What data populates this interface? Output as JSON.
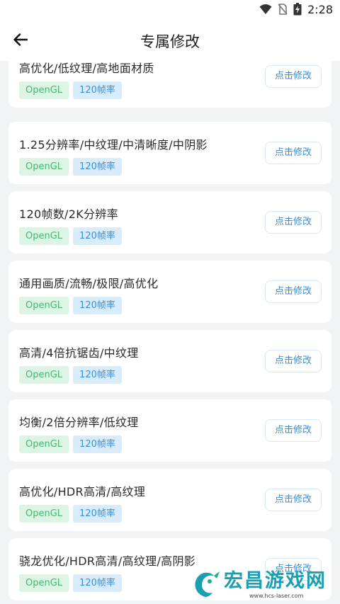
{
  "status_bar": {
    "time": "2:28"
  },
  "header": {
    "title": "专属修改"
  },
  "cards": [
    {
      "title": "高优化/低纹理/高地面材质",
      "tags": [
        "OpenGL",
        "120帧率"
      ],
      "button": "点击修改"
    },
    {
      "title": "1.25分辨率/中纹理/中清晰度/中阴影",
      "tags": [
        "OpenGL",
        "120帧率"
      ],
      "button": "点击修改"
    },
    {
      "title": "120帧数/2K分辨率",
      "tags": [
        "OpenGL",
        "120帧率"
      ],
      "button": "点击修改"
    },
    {
      "title": "通用画质/流畅/极限/高优化",
      "tags": [
        "OpenGL",
        "120帧率"
      ],
      "button": "点击修改"
    },
    {
      "title": "高清/4倍抗锯齿/中纹理",
      "tags": [
        "OpenGL",
        "120帧率"
      ],
      "button": "点击修改"
    },
    {
      "title": "均衡/2倍分辨率/低纹理",
      "tags": [
        "OpenGL",
        "120帧率"
      ],
      "button": "点击修改"
    },
    {
      "title": "高优化/HDR高清/高纹理",
      "tags": [
        "OpenGL",
        "120帧率"
      ],
      "button": "点击修改"
    },
    {
      "title": "骁龙优化/HDR高清/高纹理/高阴影",
      "tags": [
        "OpenGL",
        "120帧率"
      ],
      "button": "点击修改"
    }
  ],
  "watermark": {
    "name": "宏昌游戏网",
    "url": "www.hcs-laser.com"
  }
}
